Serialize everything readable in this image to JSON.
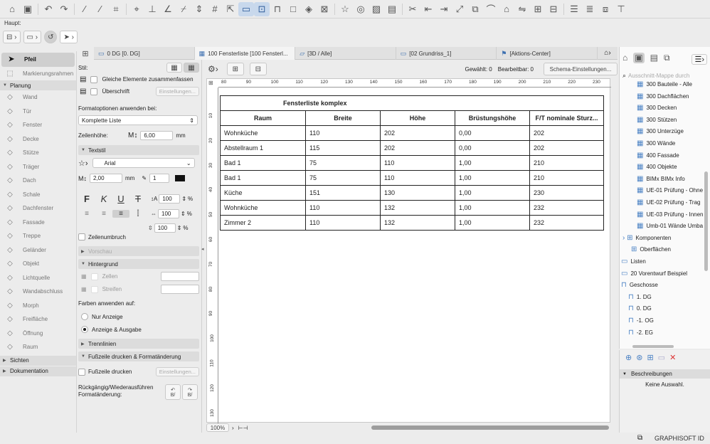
{
  "infobox": {
    "label": "Haupt:"
  },
  "toolbox": {
    "items": [
      {
        "label": "Pfeil",
        "icon": "arrow-icon"
      },
      {
        "label": "Markierungsrahmen",
        "icon": "marquee-icon"
      }
    ],
    "sections": {
      "planung": "Planung",
      "sichten": "Sichten",
      "dokumentation": "Dokumentation"
    },
    "planung_items": [
      {
        "label": "Wand",
        "icon": "wall-icon"
      },
      {
        "label": "Tür",
        "icon": "door-icon"
      },
      {
        "label": "Fenster",
        "icon": "window-icon"
      },
      {
        "label": "Decke",
        "icon": "slab-icon"
      },
      {
        "label": "Stütze",
        "icon": "column-icon"
      },
      {
        "label": "Träger",
        "icon": "beam-icon"
      },
      {
        "label": "Dach",
        "icon": "roof-icon"
      },
      {
        "label": "Schale",
        "icon": "shell-icon"
      },
      {
        "label": "Dachfenster",
        "icon": "skylight-icon"
      },
      {
        "label": "Fassade",
        "icon": "curtain-wall-icon"
      },
      {
        "label": "Treppe",
        "icon": "stair-icon"
      },
      {
        "label": "Geländer",
        "icon": "railing-icon"
      },
      {
        "label": "Objekt",
        "icon": "object-icon"
      },
      {
        "label": "Lichtquelle",
        "icon": "lamp-icon"
      },
      {
        "label": "Wandabschluss",
        "icon": "wall-end-icon"
      },
      {
        "label": "Morph",
        "icon": "morph-icon"
      },
      {
        "label": "Freifläche",
        "icon": "mesh-icon"
      },
      {
        "label": "Öffnung",
        "icon": "opening-icon"
      },
      {
        "label": "Raum",
        "icon": "zone-icon"
      }
    ]
  },
  "tabs": [
    {
      "label": "0 DG [0. DG]",
      "icon": "floorplan-icon",
      "active": false
    },
    {
      "label": "100 Fensterliste [100 Fensterl...",
      "icon": "schedule-icon",
      "active": true
    },
    {
      "label": "[3D / Alle]",
      "icon": "3d-icon",
      "active": false
    },
    {
      "label": "[02 Grundriss_1]",
      "icon": "layout-icon",
      "active": false
    },
    {
      "label": "[Aktions-Center]",
      "icon": "action-center-icon",
      "active": false
    }
  ],
  "props": {
    "stil_label": "Stil:",
    "gleiche_elemente": "Gleiche Elemente zusammenfassen",
    "ueberschrift": "Überschrift",
    "einstellungen": "Einstellungen...",
    "formatoptionen": "Formatoptionen anwenden bei:",
    "format_select": "Komplette Liste",
    "zeilenhoehe_label": "Zeilenhöhe:",
    "zeilenhoehe_value": "6,00",
    "unit_mm": "mm",
    "textstil": "Textstil",
    "font": "Arial",
    "font_size": "2,00",
    "pen": "1",
    "pct1": "100",
    "pct2": "100",
    "pct3": "100",
    "pct_unit": "%",
    "zeilenumbruch": "Zeilenumbruch",
    "vorschau": "Vorschau",
    "hintergrund": "Hintergrund",
    "zellen": "Zellen",
    "streifen": "Streifen",
    "farben_anwenden": "Farben anwenden auf:",
    "nur_anzeige": "Nur Anzeige",
    "anzeige_ausgabe": "Anzeige & Ausgabe",
    "trennlinien": "Trennlinien",
    "fusszeile_section": "Fußzeile drucken & Formatänderung",
    "fusszeile_drucken": "Fußzeile drucken",
    "einstellungen2": "Einstellungen...",
    "undo_label": "Rückgängig/Wiederausführen Formatänderung:",
    "undo_sub": "B/",
    "redo_sub": "B/"
  },
  "viewbar": {
    "gewaehlt": "Gewählt: 0",
    "bearbeitbar": "Bearbeitbar: 0",
    "schema_button": "Schema-Einstellungen..."
  },
  "ruler": {
    "h": [
      "80",
      "90",
      "100",
      "110",
      "120",
      "130",
      "140",
      "150",
      "160",
      "170",
      "180",
      "190",
      "200",
      "210",
      "220",
      "230"
    ],
    "v": [
      "10",
      "20",
      "30",
      "40",
      "50",
      "60",
      "70",
      "80",
      "90",
      "100",
      "110",
      "120",
      "130"
    ]
  },
  "schedule": {
    "title": "Fensterliste komplex",
    "headers": [
      "Raum",
      "Breite",
      "Höhe",
      "Brüstungshöhe",
      "F/T nominale Sturz..."
    ],
    "rows": [
      [
        "Wohnküche",
        "110",
        "202",
        "0,00",
        "202"
      ],
      [
        "Abstellraum 1",
        "115",
        "202",
        "0,00",
        "202"
      ],
      [
        "Bad 1",
        "75",
        "110",
        "1,00",
        "210"
      ],
      [
        "Bad 1",
        "75",
        "110",
        "1,00",
        "210"
      ],
      [
        "Küche",
        "151",
        "130",
        "1,00",
        "230"
      ],
      [
        "Wohnküche",
        "110",
        "132",
        "1,00",
        "232"
      ],
      [
        "Zimmer 2",
        "110",
        "132",
        "1,00",
        "232"
      ]
    ]
  },
  "zoom": "100%",
  "navigator": {
    "search_placeholder": "Ausschnitt-Mappe durch",
    "items": [
      "300 Bauteile - Alle",
      "300 Dachflächen",
      "300 Decken",
      "300 Stützen",
      "300 Unterzüge",
      "300 Wände",
      "400 Fassade",
      "400 Objekte",
      "BIMx BIMx Info",
      "UE-01 Prüfung - Ohne",
      "UE-02 Prüfung - Trag",
      "UE-03 Prüfung - Innen",
      "Umb-01 Wände Umba"
    ],
    "komponenten": "Komponenten",
    "oberflaechen": "Oberflächen",
    "listen": "Listen",
    "vorentwurf": "20 Vorentwurf Beispiel",
    "geschosse": "Geschosse",
    "floors": [
      "1. DG",
      "0. DG",
      "-1. OG",
      "-2. EG"
    ]
  },
  "desc": {
    "header": "Beschreibungen",
    "empty": "Keine Auswahl."
  },
  "status": {
    "brand": "GRAPHISOFT ID"
  }
}
